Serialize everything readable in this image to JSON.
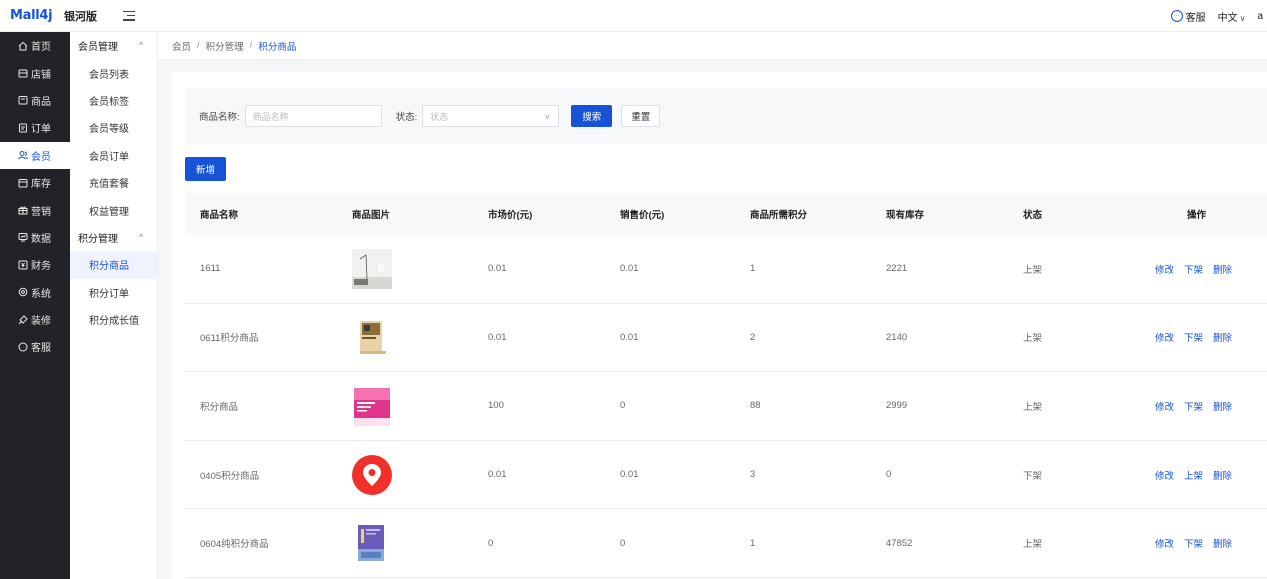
{
  "header": {
    "logo": "Mall4j",
    "version": "银河版",
    "customer_service": "客服",
    "language": "中文",
    "avatar_initial": "a"
  },
  "sidebar": {
    "items": [
      {
        "label": "首页",
        "icon": "home-icon"
      },
      {
        "label": "店铺",
        "icon": "shop-icon"
      },
      {
        "label": "商品",
        "icon": "goods-icon"
      },
      {
        "label": "订单",
        "icon": "order-icon"
      },
      {
        "label": "会员",
        "icon": "member-icon",
        "active": true
      },
      {
        "label": "库存",
        "icon": "stock-icon"
      },
      {
        "label": "营销",
        "icon": "gift-icon"
      },
      {
        "label": "数据",
        "icon": "data-icon"
      },
      {
        "label": "财务",
        "icon": "finance-icon"
      },
      {
        "label": "系统",
        "icon": "system-icon"
      },
      {
        "label": "装修",
        "icon": "decorate-icon"
      },
      {
        "label": "客服",
        "icon": "service-icon"
      }
    ]
  },
  "submenu": {
    "group1": "会员管理",
    "group1_items": [
      "会员列表",
      "会员标签",
      "会员等级",
      "会员订单",
      "充值套餐",
      "权益管理"
    ],
    "group2": "积分管理",
    "group2_items": [
      "积分商品",
      "积分订单",
      "积分成长值"
    ]
  },
  "breadcrumb": [
    "会员",
    "积分管理",
    "积分商品"
  ],
  "search": {
    "name_label": "商品名称:",
    "name_placeholder": "商品名称",
    "status_label": "状态:",
    "status_placeholder": "状态",
    "search_button": "搜索",
    "reset_button": "重置"
  },
  "add_button": "新增",
  "table": {
    "headers": [
      "商品名称",
      "商品图片",
      "市场价(元)",
      "销售价(元)",
      "商品所需积分",
      "现有库存",
      "状态",
      "操作"
    ],
    "rows": [
      {
        "name": "1611",
        "image": "room-photo",
        "market_price": "0.01",
        "sale_price": "0.01",
        "points": "1",
        "stock": "2221",
        "status": "上架",
        "ops": [
          "修改",
          "下架",
          "删除"
        ]
      },
      {
        "name": "0611积分商品",
        "image": "book-cover",
        "market_price": "0.01",
        "sale_price": "0.01",
        "points": "2",
        "stock": "2140",
        "status": "上架",
        "ops": [
          "修改",
          "下架",
          "删除"
        ]
      },
      {
        "name": "积分商品",
        "image": "pink-cosmetic-box",
        "market_price": "100",
        "sale_price": "0",
        "points": "88",
        "stock": "2999",
        "status": "上架",
        "ops": [
          "修改",
          "下架",
          "删除"
        ]
      },
      {
        "name": "0405积分商品",
        "image": "red-location-pin",
        "market_price": "0.01",
        "sale_price": "0.01",
        "points": "3",
        "stock": "0",
        "status": "下架",
        "ops": [
          "修改",
          "上架",
          "删除"
        ]
      },
      {
        "name": "0604纯积分商品",
        "image": "purple-book",
        "market_price": "0",
        "sale_price": "0",
        "points": "1",
        "stock": "47852",
        "status": "上架",
        "ops": [
          "修改",
          "下架",
          "删除"
        ]
      }
    ]
  },
  "colors": {
    "primary": "#1753d6",
    "sidebar_bg": "#222328"
  }
}
